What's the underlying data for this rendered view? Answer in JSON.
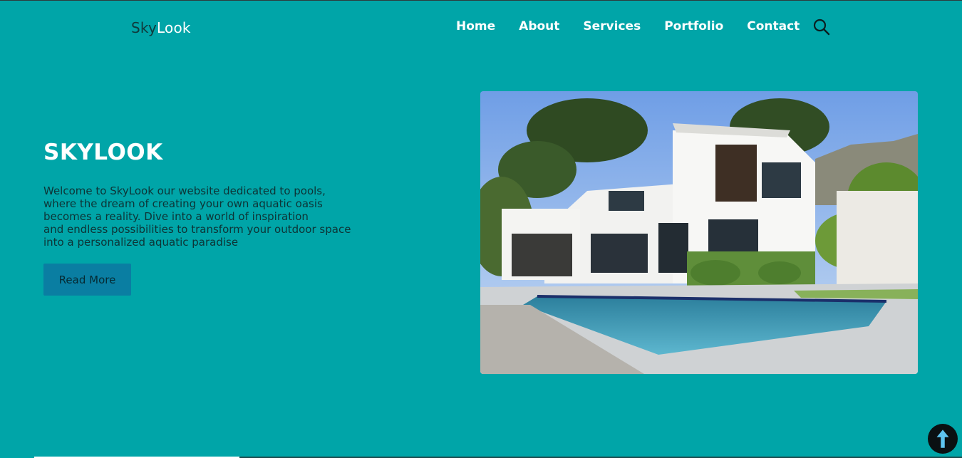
{
  "brand": {
    "part1": "Sky",
    "part2": "Look"
  },
  "nav": {
    "items": [
      "Home",
      "About",
      "Services",
      "Portfolio",
      "Contact"
    ]
  },
  "icons": {
    "search": "search-icon",
    "scroll_top": "arrow-up-icon"
  },
  "hero": {
    "title": "SKYLOOK",
    "lines": [
      "Welcome to SkyLook our website dedicated to pools,",
      "where the dream of creating your own aquatic oasis",
      "becomes a reality. Dive into a world of inspiration",
      "and endless possibilities to transform your outdoor space",
      "into a personalized aquatic paradise"
    ],
    "button": "Read More"
  },
  "colors": {
    "background": "#00a5a8",
    "button": "#0a7ea2",
    "text_dark": "#0d3436",
    "white": "#ffffff"
  }
}
